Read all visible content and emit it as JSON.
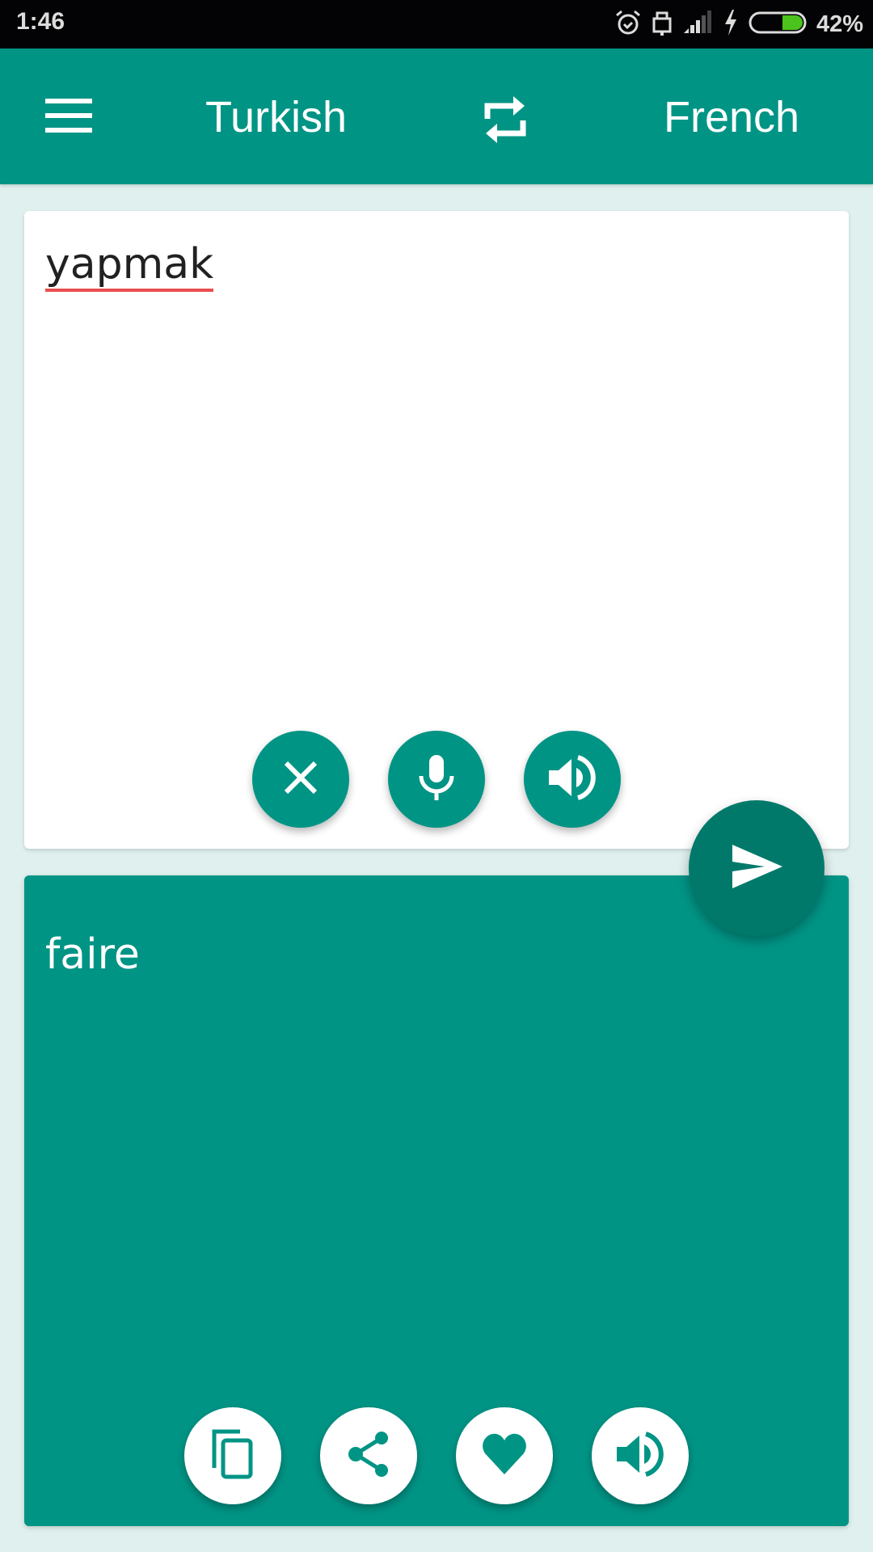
{
  "status_bar": {
    "time": "1:46",
    "icons": [
      "alarm-icon",
      "lock-icon",
      "signal-icon",
      "charging-icon",
      "battery-icon"
    ],
    "battery_percent": "42%",
    "battery_level": 0.42,
    "battery_color": "#4cc21c"
  },
  "app_bar": {
    "menu_icon": "hamburger-menu-icon",
    "source_language": "Turkish",
    "swap_icon": "swap-languages-icon",
    "target_language": "French",
    "color": "#009485"
  },
  "source": {
    "text": "yapmak",
    "spellcheck_underline_color": "#e94e4e",
    "actions": [
      {
        "name": "clear",
        "icon": "close-icon"
      },
      {
        "name": "voice-input",
        "icon": "microphone-icon"
      },
      {
        "name": "speak",
        "icon": "speaker-icon"
      }
    ]
  },
  "translate_button": {
    "icon": "send-icon",
    "color": "#00796b"
  },
  "result": {
    "text": "faire",
    "actions": [
      {
        "name": "copy",
        "icon": "copy-icon"
      },
      {
        "name": "share",
        "icon": "share-icon"
      },
      {
        "name": "favorite",
        "icon": "heart-icon"
      },
      {
        "name": "speak",
        "icon": "speaker-icon"
      }
    ]
  }
}
